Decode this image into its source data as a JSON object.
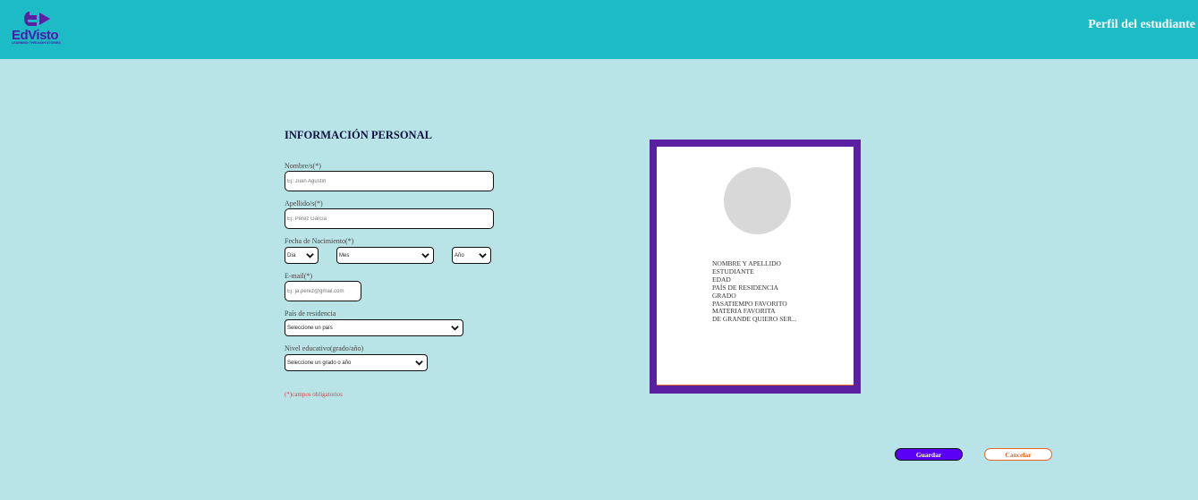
{
  "header": {
    "brand": "EdVisto",
    "tagline": "LEARNING THROUGH STORIES",
    "title": "Perfil del estudiante",
    "colors": {
      "bar": "#1dbbc6",
      "logo": "#5b1fa2"
    }
  },
  "form": {
    "section_title": "INFORMACIÓN PERSONAL",
    "first_name": {
      "label": "Nombre/s(*)",
      "placeholder": "Ej: Juan Agustín"
    },
    "last_name": {
      "label": "Apellido/s(*)",
      "placeholder": "Ej: Pérez García"
    },
    "birth_date": {
      "label": "Fecha de Nacimiento(*)",
      "day": "Día",
      "month": "Mes",
      "year": "Año"
    },
    "email": {
      "label": "E-mail(*)",
      "placeholder": "Ej: ja.perez@gmail.com"
    },
    "country": {
      "label": "País de residencia",
      "selected": "Seleccione un país"
    },
    "education": {
      "label": "Nivel educativo(grado/año)",
      "selected": "Seleccione un grado o año"
    },
    "required_note": "(*)campos obligatorios"
  },
  "card": {
    "lines": [
      "NOMBRE Y APELLIDO",
      "ESTUDIANTE",
      "EDAD",
      "PAÍS DE RESIDENCIA",
      "GRADO",
      "PASATIEMPO FAVORITO",
      "MATERIA FAVORITA",
      "DE GRANDE QUIERO SER..."
    ],
    "colors": {
      "frame": "#5b1fa2",
      "avatar": "#d8d8d8"
    }
  },
  "actions": {
    "save_label": "Guardar",
    "cancel_label": "Cancelar",
    "colors": {
      "save": "#5b00f5",
      "cancel": "#e46a2a"
    }
  }
}
